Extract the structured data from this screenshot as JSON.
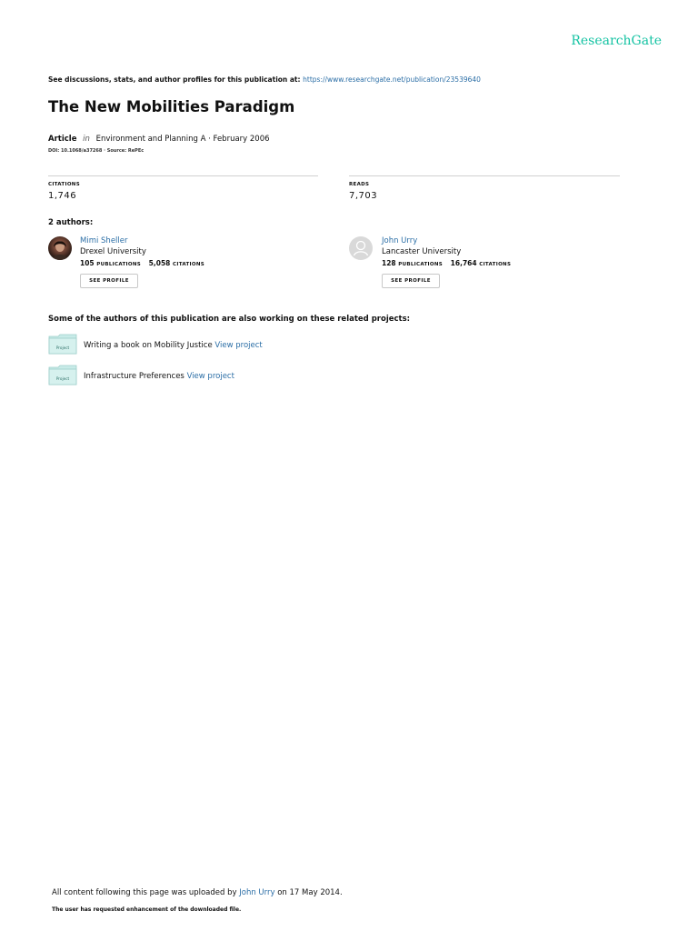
{
  "brand": "ResearchGate",
  "discussion": {
    "prefix": "See discussions, stats, and author profiles for this publication at:",
    "url": "https://www.researchgate.net/publication/23539640"
  },
  "title": "The New Mobilities Paradigm",
  "article": {
    "type": "Article",
    "in": "in",
    "venue": "Environment and Planning A · February 2006",
    "doi": "DOI: 10.1068/a37268 · Source: RePEc"
  },
  "stats": {
    "citations_label": "CITATIONS",
    "citations": "1,746",
    "reads_label": "READS",
    "reads": "7,703"
  },
  "authors_heading": "2 authors:",
  "authors": [
    {
      "name": "Mimi Sheller",
      "institution": "Drexel University",
      "publications": "105",
      "publications_label": "PUBLICATIONS",
      "citations": "5,058",
      "citations_label": "CITATIONS",
      "button": "SEE PROFILE"
    },
    {
      "name": "John Urry",
      "institution": "Lancaster University",
      "publications": "128",
      "publications_label": "PUBLICATIONS",
      "citations": "16,764",
      "citations_label": "CITATIONS",
      "button": "SEE PROFILE"
    }
  ],
  "projects_heading": "Some of the authors of this publication are also working on these related projects:",
  "projects": [
    {
      "badge": "Project",
      "text": "Writing a book on Mobility Justice",
      "link": "View project"
    },
    {
      "badge": "Project",
      "text": "Infrastructure Preferences",
      "link": "View project"
    }
  ],
  "footer": {
    "prefix": "All content following this page was uploaded by",
    "uploader": "John Urry",
    "suffix": "on 17 May 2014.",
    "note": "The user has requested enhancement of the downloaded file."
  },
  "colors": {
    "brand": "#15c3a3",
    "link": "#2b6ea6",
    "folder": "#c8ebe8"
  }
}
